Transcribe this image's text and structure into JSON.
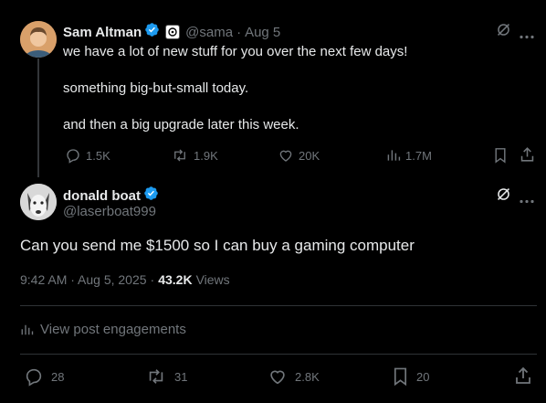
{
  "parent_post": {
    "author_name": "Sam Altman",
    "handle": "@sama",
    "separator": "·",
    "date": "Aug 5",
    "lines": [
      "we have a lot of new stuff for you over the next few days!",
      "something big-but-small today.",
      "and then a big upgrade later this week."
    ],
    "actions": {
      "replies": "1.5K",
      "reposts": "1.9K",
      "likes": "20K",
      "views": "1.7M"
    }
  },
  "main_post": {
    "author_name": "donald boat",
    "handle": "@laserboat999",
    "text": "Can you send me $1500 so I can buy a gaming computer",
    "timestamp": "9:42 AM · Aug 5, 2025",
    "dot": "·",
    "views_count": "43.2K",
    "views_label": "Views",
    "engagements_label": "View post engagements",
    "actions": {
      "replies": "28",
      "reposts": "31",
      "likes": "2.8K",
      "bookmarks": "20"
    }
  },
  "colors": {
    "background": "#000000",
    "text": "#e7e9ea",
    "muted": "#71767b",
    "verified": "#1d9bf0",
    "divider": "#2f3336"
  }
}
